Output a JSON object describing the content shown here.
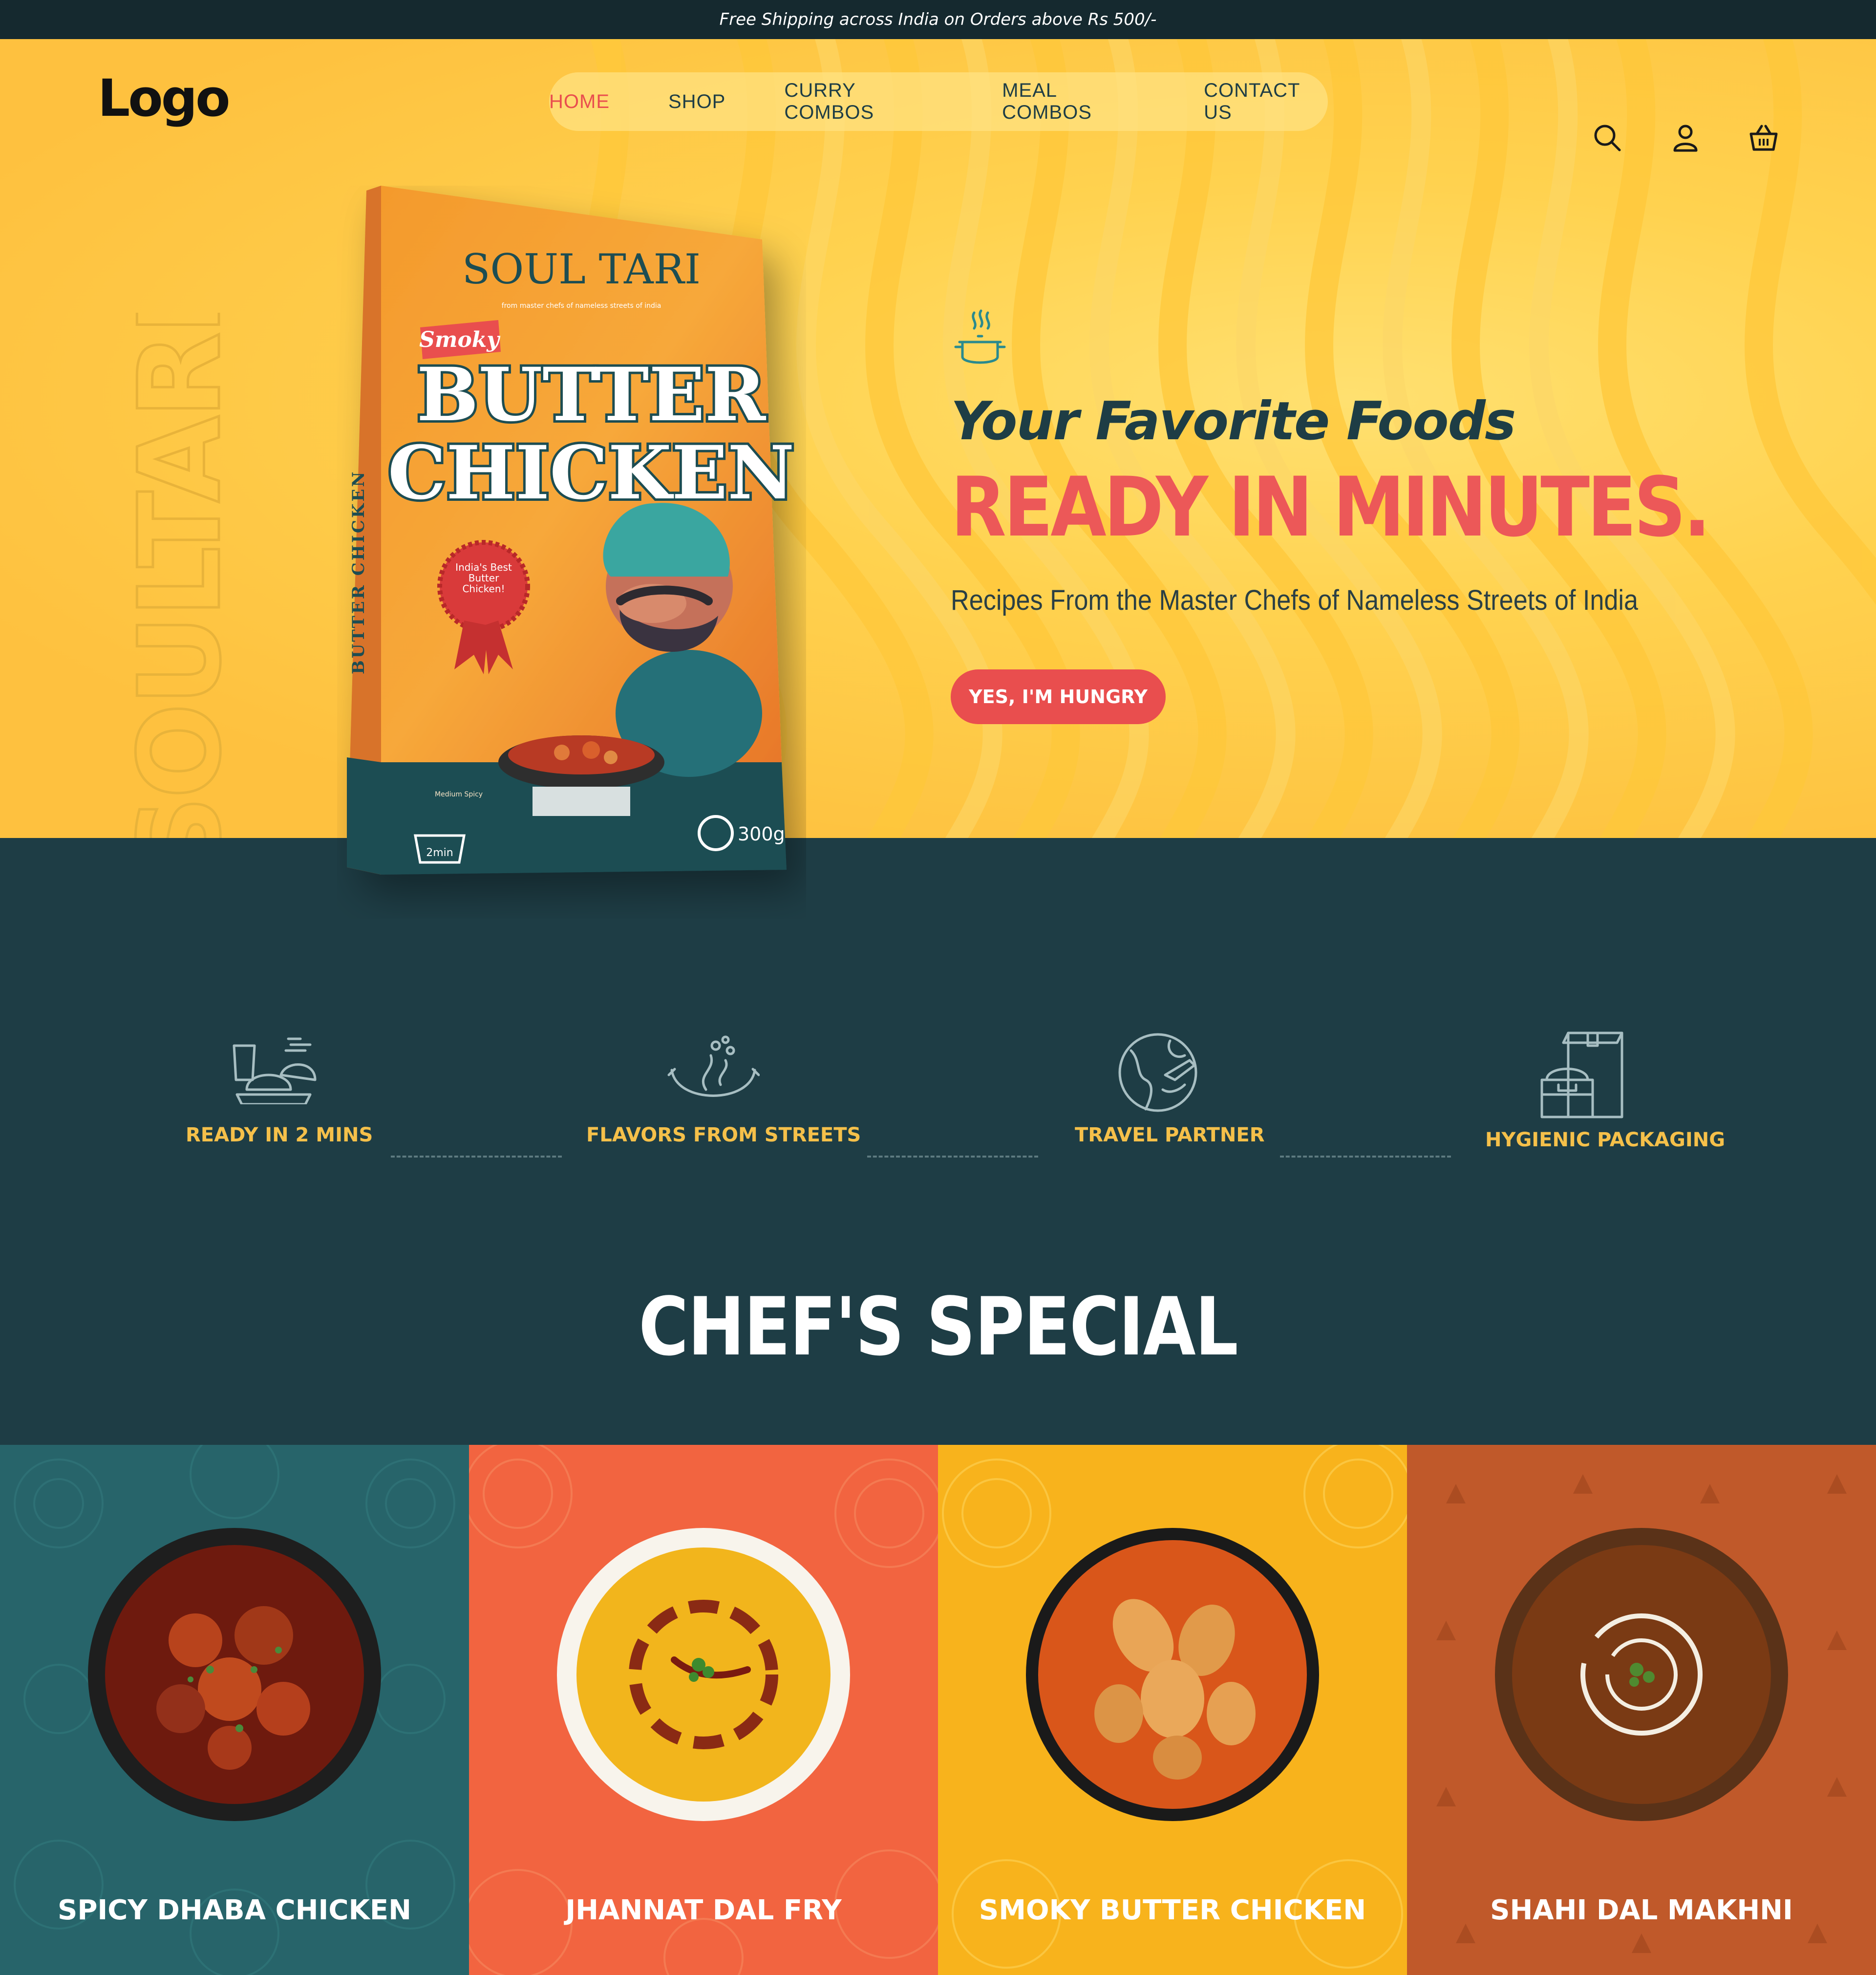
{
  "topbar": {
    "text": "Free Shipping across India on Orders above Rs 500/-"
  },
  "header": {
    "logo": "Logo",
    "nav": [
      {
        "label": "HOME",
        "active": true
      },
      {
        "label": "SHOP",
        "active": false
      },
      {
        "label": "CURRY COMBOS",
        "active": false
      },
      {
        "label": "MEAL COMBOS",
        "active": false
      },
      {
        "label": "CONTACT US",
        "active": false
      }
    ],
    "icons": [
      "search-icon",
      "user-icon",
      "basket-icon"
    ]
  },
  "hero": {
    "vertical_brand": "SOULTARI",
    "package": {
      "brand": "SOUL TARI",
      "tagline": "from master chefs of nameless streets of india",
      "flavor": "Smoky",
      "product_line1": "BUTTER",
      "product_line2": "CHICKEN",
      "badge": "India's Best Butter Chicken!",
      "spice": "Medium Spicy",
      "time": "2min",
      "weight": "300g",
      "side_text": "BUTTER CHICKEN"
    },
    "headline_small": "Your Favorite Foods",
    "headline_big": "READY IN MINUTES.",
    "subheadline": "Recipes From the Master Chefs of Nameless Streets of India",
    "cta": "YES, I'M HUNGRY"
  },
  "features": [
    {
      "label": "READY IN 2 MINS",
      "icon": "meal-tray-icon"
    },
    {
      "label": "FLAVORS FROM STREETS",
      "icon": "spice-bowl-icon"
    },
    {
      "label": "TRAVEL PARTNER",
      "icon": "globe-plane-icon"
    },
    {
      "label": "HYGIENIC PACKAGING",
      "icon": "package-box-icon"
    }
  ],
  "section_title": "CHEF'S SPECIAL",
  "specials": [
    {
      "name": "SPICY DHABA CHICKEN",
      "bg": "#27646a"
    },
    {
      "name": "JHANNAT DAL FRY",
      "bg": "#f26440"
    },
    {
      "name": "SMOKY BUTTER CHICKEN",
      "bg": "#f8b31c"
    },
    {
      "name": "SHAHI DAL MAKHNI",
      "bg": "#c0592a"
    }
  ],
  "colors": {
    "accent": "#e94e4e",
    "dark_teal": "#1e3d45",
    "hero_yellow": "#ffd24f",
    "feature_gold": "#f5c04a"
  }
}
